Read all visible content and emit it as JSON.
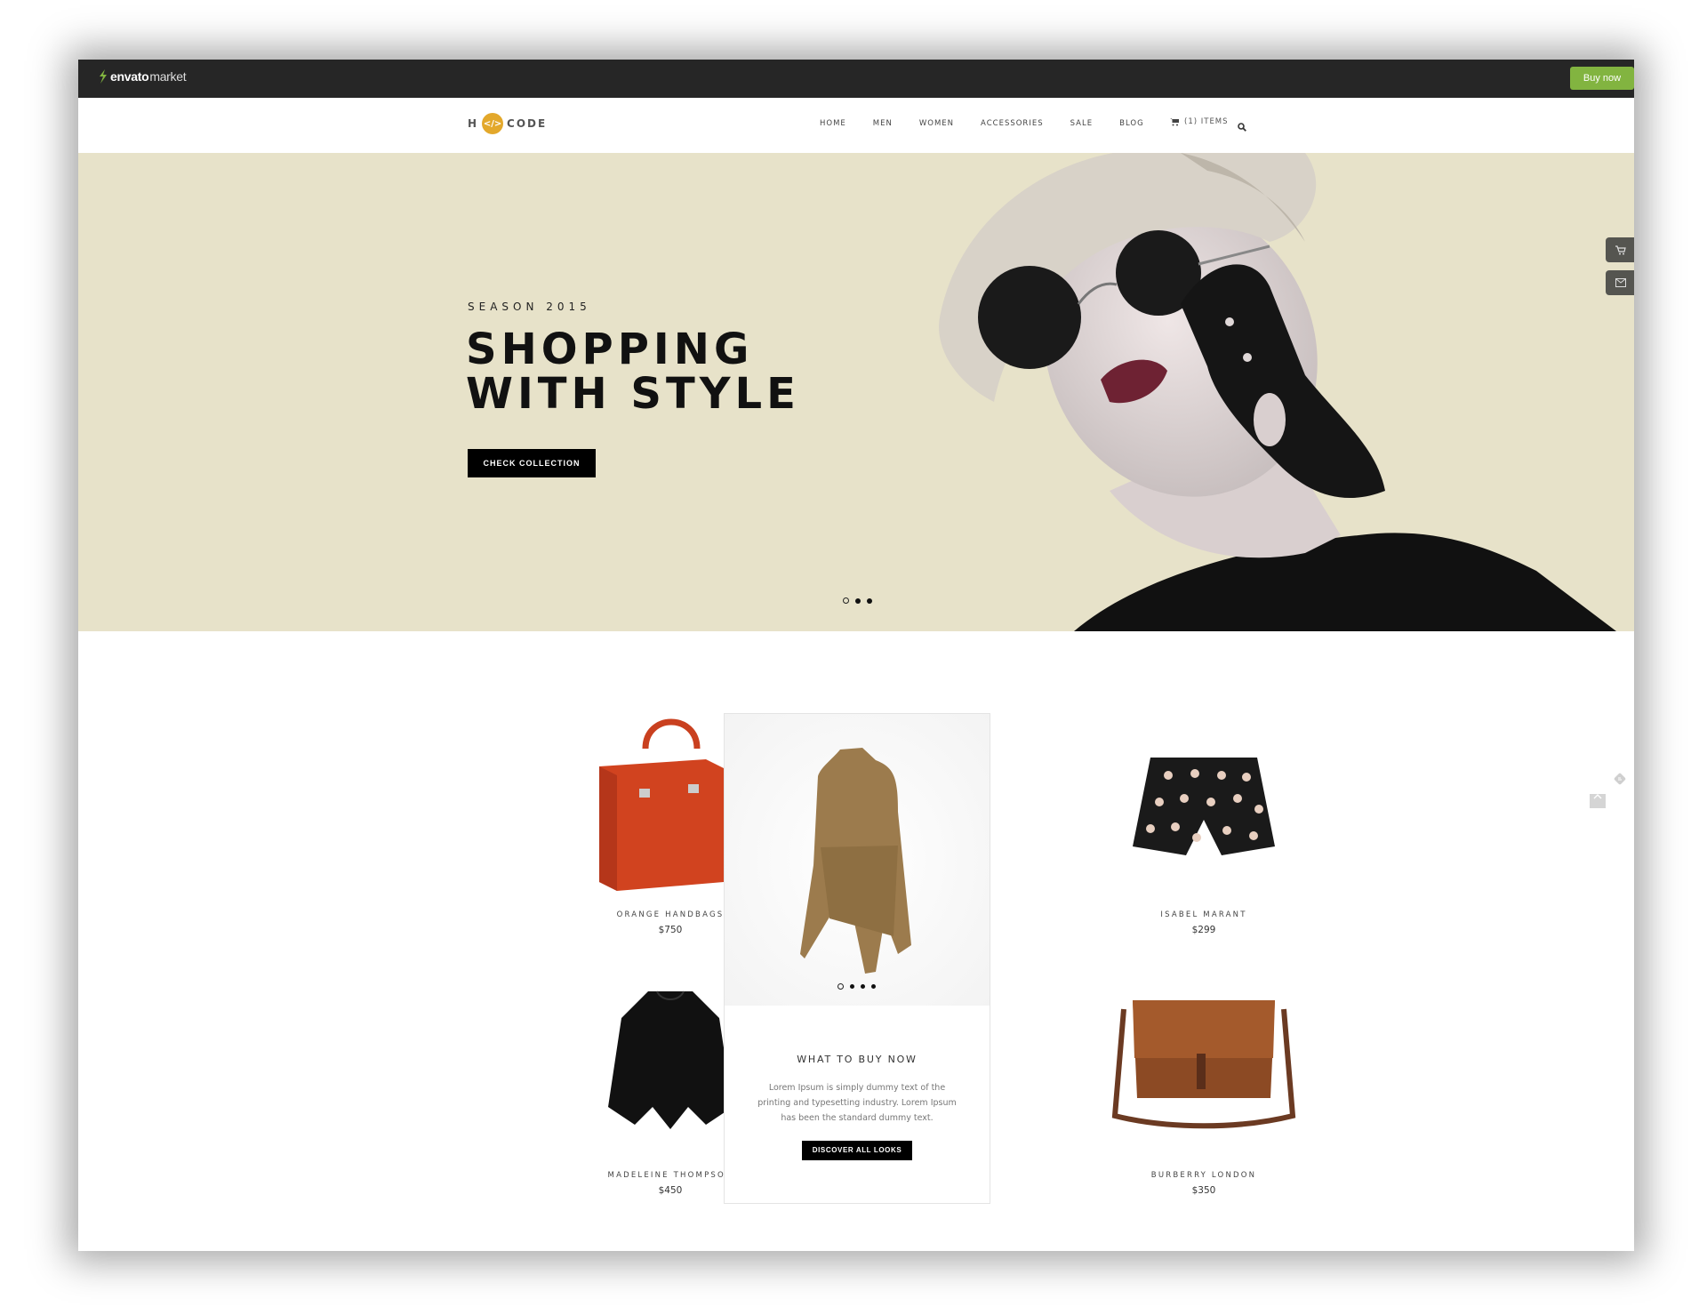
{
  "envato": {
    "logo_word": "envato",
    "logo_suffix": "market",
    "buy_now_label": "Buy now",
    "accent_color": "#82b440"
  },
  "header": {
    "brand_left": "H",
    "brand_badge": "</>",
    "brand_right": "CODE",
    "brand_color": "#e3a82b",
    "nav": [
      "HOME",
      "MEN",
      "WOMEN",
      "ACCESSORIES",
      "SALE",
      "BLOG"
    ],
    "cart_label": "(1) ITEMS",
    "search_icon": "search-icon"
  },
  "hero": {
    "subtitle": "SEASON 2015",
    "title_line1": "SHOPPING",
    "title_line2": "WITH STYLE",
    "cta_label": "CHECK COLLECTION",
    "slides": 3,
    "active_slide": 1
  },
  "side_tools": [
    "cart-icon",
    "mail-icon"
  ],
  "products": [
    {
      "name": "ORANGE HANDBAGS",
      "price": "$750"
    },
    {
      "name": "ISABEL MARANT",
      "price": "$299"
    },
    {
      "name": "MADELEINE THOMPSON",
      "price": "$450"
    },
    {
      "name": "BURBERRY LONDON",
      "price": "$350"
    }
  ],
  "feature": {
    "title": "WHAT TO BUY NOW",
    "text": "Lorem Ipsum is simply dummy text of the printing and typesetting industry. Lorem Ipsum has been the standard dummy text.",
    "cta_label": "DISCOVER ALL LOOKS",
    "slides": 4,
    "active_slide": 1
  }
}
